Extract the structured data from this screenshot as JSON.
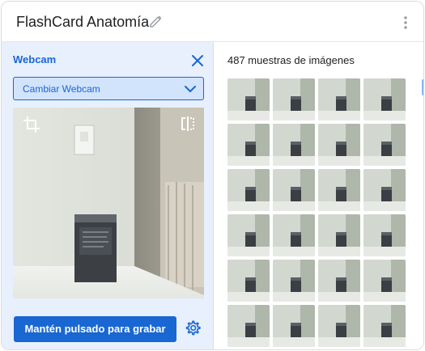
{
  "header": {
    "title": "FlashCard Anatomía",
    "edit_icon": "pencil-icon",
    "menu_icon": "more-vert-icon"
  },
  "webcam_panel": {
    "label": "Webcam",
    "close_icon": "close-icon",
    "select": {
      "selected": "Cambiar Webcam",
      "icon": "chevron-down-icon"
    },
    "preview_icons": [
      "crop-icon",
      "flip-horizontal-icon"
    ],
    "record_button": "Mantén pulsado para grabar",
    "settings_icon": "gear-icon"
  },
  "samples_panel": {
    "count_label": "487 muestras de imágenes",
    "rows": 6,
    "cols": 4
  },
  "colors": {
    "accent": "#1967d2",
    "panel_bg": "#e8f0fe",
    "select_bg": "#d2e3fc"
  }
}
